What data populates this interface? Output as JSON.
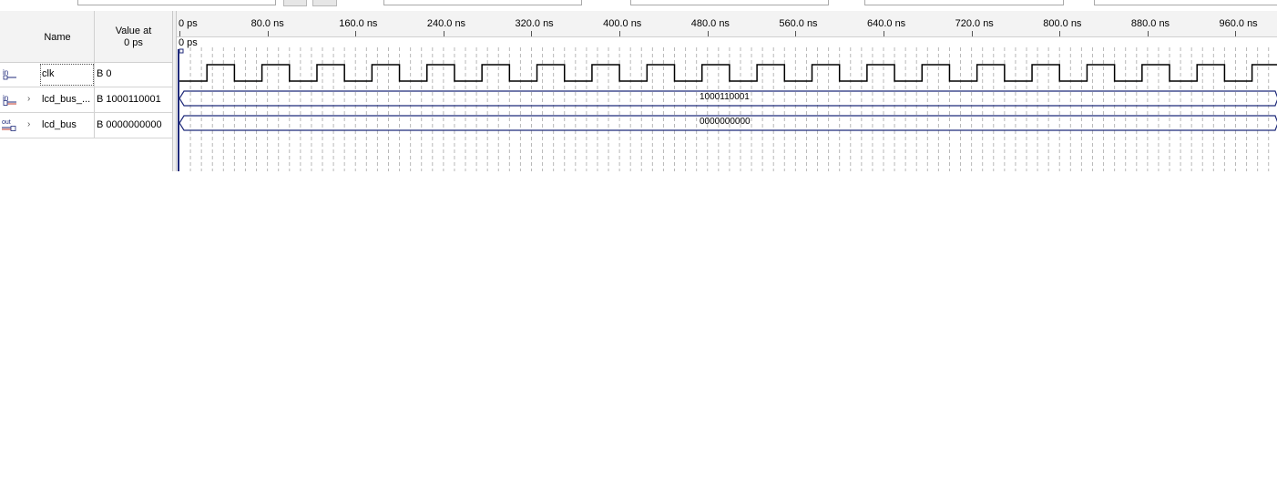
{
  "header": {
    "name": "Name",
    "value_at_line1": "Value at",
    "value_at_line2": "0 ps"
  },
  "signals": [
    {
      "icon": "input-pin-icon",
      "icon_text": "in",
      "expandable": false,
      "name": "clk",
      "value": "B 0",
      "type": "clock"
    },
    {
      "icon": "input-bus-icon",
      "icon_text": "in",
      "expandable": true,
      "name": "lcd_bus_...",
      "value": "B 1000110001",
      "type": "bus",
      "bus_value": "1000110001"
    },
    {
      "icon": "output-bus-icon",
      "icon_text": "out",
      "expandable": true,
      "name": "lcd_bus",
      "value": "B 0000000000",
      "type": "bus",
      "bus_value": "0000000000"
    }
  ],
  "ruler": {
    "ticks": [
      "0 ps",
      "80.0 ns",
      "160.0 ns",
      "240.0 ns",
      "320.0 ns",
      "400.0 ns",
      "480.0 ns",
      "560.0 ns",
      "640.0 ns",
      "720.0 ns",
      "800.0 ns",
      "880.0 ns",
      "960.0 ns"
    ],
    "cursor_label": "0 ps"
  },
  "clock": {
    "period_ns": 50,
    "low_first_ns": 25
  },
  "colors": {
    "wave": "#000000",
    "bus": "#1f2a7a",
    "grid": "#b8b8b8",
    "cursor": "#1f2a7a"
  }
}
